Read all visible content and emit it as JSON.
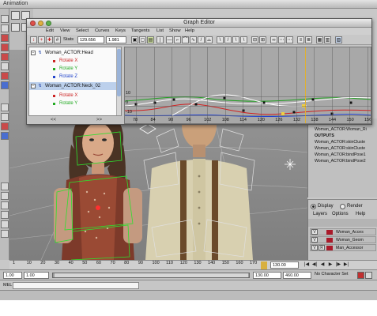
{
  "app": {
    "title": "Animation"
  },
  "graph_editor": {
    "title": "Graph Editor",
    "menu": [
      "Edit",
      "View",
      "Select",
      "Curves",
      "Keys",
      "Tangents",
      "List",
      "Show",
      "Help"
    ],
    "stats_label": "Stats",
    "stats_frame": "129.656",
    "stats_value": "1.981",
    "outliner": [
      {
        "label": "Woman_ACTOR:Head",
        "type": "node",
        "expanded": true
      },
      {
        "label": "Rotate X",
        "type": "channel",
        "color": "#cc2222"
      },
      {
        "label": "Rotate Y",
        "type": "channel",
        "color": "#22aa22"
      },
      {
        "label": "Rotate Z",
        "type": "channel",
        "color": "#2244cc"
      },
      {
        "label": "Woman_ACTOR:Neck_02",
        "type": "node",
        "expanded": true,
        "selected": true
      },
      {
        "label": "Rotate X",
        "type": "channel",
        "color": "#cc2222"
      },
      {
        "label": "Rotate Y",
        "type": "channel",
        "color": "#22aa22"
      }
    ],
    "outliner_footer": [
      "<<",
      ">>"
    ],
    "frame_ticks": [
      "78",
      "84",
      "90",
      "96",
      "102",
      "108",
      "114",
      "120",
      "126",
      "132",
      "138",
      "144",
      "150",
      "156"
    ],
    "value_ticks": [
      "10",
      "0",
      "-10"
    ]
  },
  "channel_box": {
    "lines": [
      {
        "text": "Woman_ACTOR:spine",
        "bold": false
      },
      {
        "text": "Woman_ACTOR:Woman_Ri",
        "bold": false
      },
      {
        "text": "OUTPUTS",
        "bold": true
      },
      {
        "text": "Woman_ACTOR:skinCluste",
        "bold": false
      },
      {
        "text": "Woman_ACTOR:skinCluste",
        "bold": false
      },
      {
        "text": "Woman_ACTOR:bindPose1",
        "bold": false
      },
      {
        "text": "Woman_ACTOR:bindPose2",
        "bold": false
      }
    ]
  },
  "layers": {
    "display_label": "Display",
    "render_label": "Render",
    "menu": [
      "Layers",
      "Options",
      "Help"
    ],
    "rows": [
      {
        "v": "V",
        "name": "Woman_Acces"
      },
      {
        "v": "V",
        "name": "Woman_Geom"
      },
      {
        "v": "V",
        "name": "Man_Accessor"
      }
    ],
    "row_flags": [
      "",
      "",
      "R"
    ]
  },
  "time_slider": {
    "ticks": [
      "1",
      "10",
      "20",
      "30",
      "40",
      "50",
      "60",
      "70",
      "80",
      "90",
      "100",
      "110",
      "120",
      "130",
      "140",
      "150",
      "160",
      "170"
    ],
    "current_frame": "130.00",
    "controls": [
      "|◀",
      "◀|",
      "◀",
      "▶",
      "|▶",
      "▶|"
    ]
  },
  "range": {
    "start": "1.00",
    "inner_start": "1.00",
    "inner_end": "130.00",
    "end": "460.00",
    "character_set": "No Character Set"
  },
  "command_line": {
    "label": "MEL"
  },
  "colors": {
    "accent_red": "#aa1a2a",
    "curve_red": "#d02020",
    "curve_green": "#20a020",
    "curve_blue": "#2040d0",
    "time_marker": "#e0b030"
  }
}
